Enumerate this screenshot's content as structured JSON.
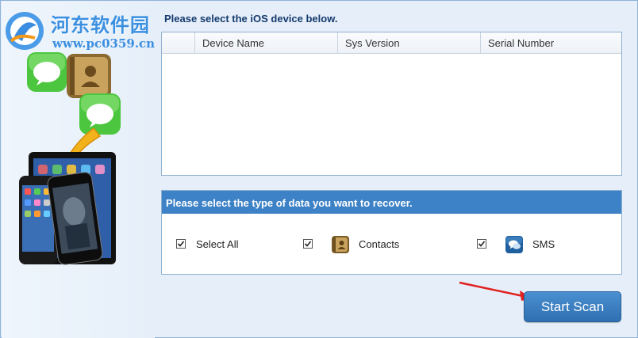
{
  "watermark": {
    "title": "河东软件园",
    "url": "www.pc0359.cn"
  },
  "device_section": {
    "heading": "Please select the iOS device below.",
    "columns": [
      "",
      "Device Name",
      "Sys Version",
      "Serial Number"
    ],
    "rows": []
  },
  "data_section": {
    "heading": "Please select the type of data you want to recover.",
    "options": [
      {
        "label": "Select All",
        "checked": true,
        "icon": "none"
      },
      {
        "label": "Contacts",
        "checked": true,
        "icon": "contacts-book-icon"
      },
      {
        "label": "SMS",
        "checked": true,
        "icon": "sms-bubble-icon"
      }
    ]
  },
  "actions": {
    "start_scan_label": "Start Scan"
  },
  "colors": {
    "accent": "#3d82c6",
    "button": "#3a7dc0",
    "arrow": "#e02020",
    "heading_text": "#153a6e"
  }
}
